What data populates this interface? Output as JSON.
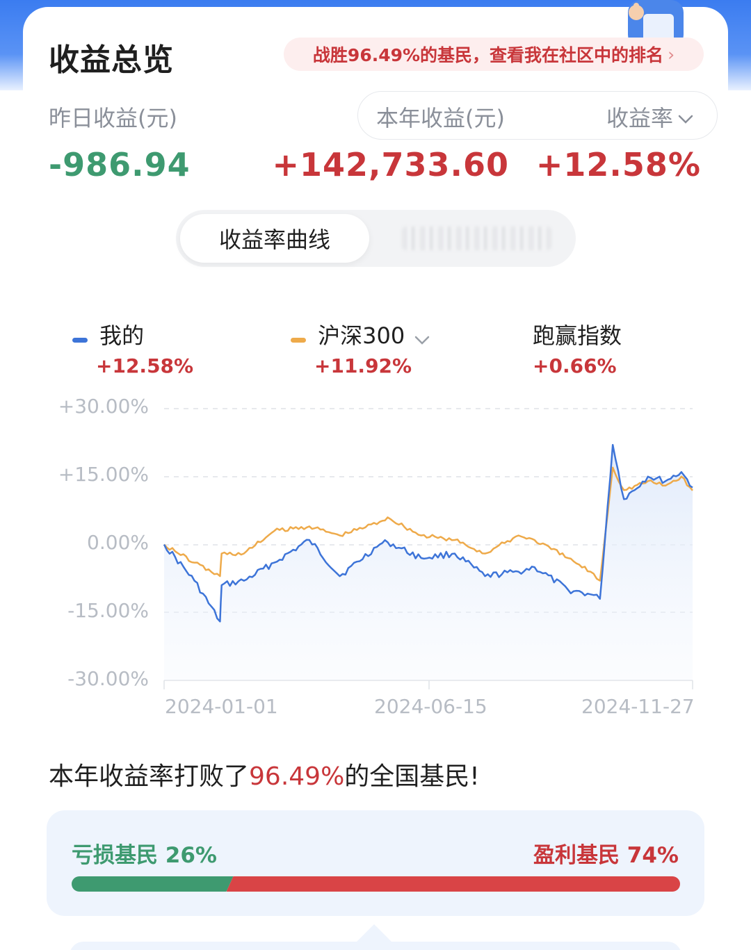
{
  "header": {
    "title": "收益总览",
    "rank_banner": "战胜96.49%的基民，查看我在社区中的排名",
    "rank_chevron": "›"
  },
  "summary": {
    "yesterday_label": "昨日收益(元)",
    "yesterday_value": "-986.94",
    "year_label": "本年收益(元)",
    "year_value": "+142,733.60",
    "rate_label": "收益率",
    "rate_value": "+12.58%"
  },
  "tabs": {
    "active": "收益率曲线"
  },
  "legend": [
    {
      "name": "我的",
      "value": "+12.58%",
      "color": "#3d74d8"
    },
    {
      "name": "沪深300",
      "value": "+11.92%",
      "color": "#eeaa4a"
    },
    {
      "name": "跑赢指数",
      "value": "+0.66%"
    }
  ],
  "chart_data": {
    "type": "line",
    "y_tick_labels": [
      "+30.00%",
      "+15.00%",
      "0.00%",
      "-15.00%",
      "-30.00%"
    ],
    "ylim": [
      -30,
      30
    ],
    "x_tick_labels": [
      "2024-01-01",
      "2024-06-15",
      "2024-11-27"
    ],
    "x": [
      "2024-01-01",
      "2024-01-20",
      "2024-02-05",
      "2024-02-06",
      "2024-02-20",
      "2024-03-10",
      "2024-04-01",
      "2024-04-20",
      "2024-05-15",
      "2024-05-20",
      "2024-06-10",
      "2024-07-01",
      "2024-07-20",
      "2024-08-10",
      "2024-08-20",
      "2024-09-10",
      "2024-09-24",
      "2024-09-30",
      "2024-10-08",
      "2024-10-15",
      "2024-10-30",
      "2024-11-10",
      "2024-11-20",
      "2024-11-27"
    ],
    "series": [
      {
        "name": "我的",
        "color": "#3d74d8",
        "values": [
          0,
          -8,
          -17,
          -9,
          -8,
          -4,
          1,
          -7,
          0,
          0.5,
          -3,
          -2,
          -7,
          -6,
          -5,
          -10,
          -11,
          -12,
          22,
          10,
          15,
          14,
          16,
          12.58
        ]
      },
      {
        "name": "沪深300",
        "color": "#eeaa4a",
        "values": [
          0,
          -4,
          -7,
          -2,
          -2,
          3,
          4,
          2,
          5,
          6,
          2,
          1,
          -2,
          2,
          1,
          -3,
          -6,
          -8,
          17,
          12,
          14,
          13,
          15,
          11.92
        ]
      }
    ],
    "grid": "dashed-horizontal",
    "legend_position": "top"
  },
  "beat": {
    "prefix": "本年收益率打败了",
    "percent": "96.49%",
    "suffix": "的全国基民!"
  },
  "distribution": {
    "loss_label": "亏损基民 26%",
    "gain_label": "盈利基民 74%",
    "loss_ratio": 0.26,
    "gain_ratio": 0.74,
    "loss_color": "#3e9a70",
    "gain_color": "#d94446"
  }
}
